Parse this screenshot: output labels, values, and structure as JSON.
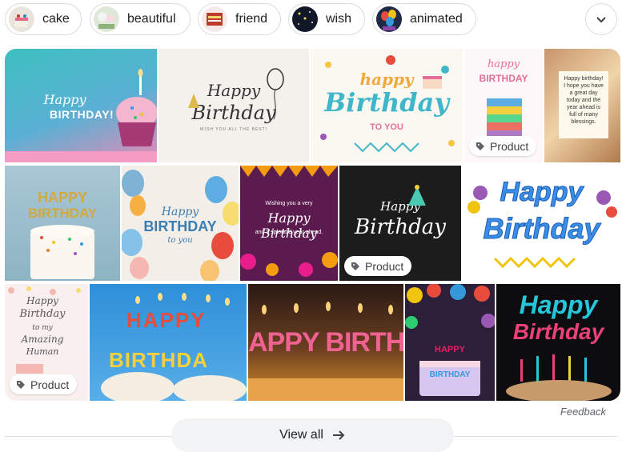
{
  "chips": [
    {
      "label": "cake",
      "icon": "cake-thumbnail"
    },
    {
      "label": "beautiful",
      "icon": "flowers-thumbnail"
    },
    {
      "label": "friend",
      "icon": "friend-card-thumbnail"
    },
    {
      "label": "wish",
      "icon": "night-sky-thumbnail"
    },
    {
      "label": "animated",
      "icon": "balloons-thumbnail"
    }
  ],
  "expand_icon": "chevron-down-icon",
  "tiles": {
    "t1": {
      "line1": "Happy",
      "line2": "BIRTHDAY!"
    },
    "t2": {
      "line1": "Happy",
      "line2": "Birthday",
      "sub": "WISH YOU ALL THE BEST!"
    },
    "t3": {
      "line1": "happy",
      "line2": "Birthday",
      "line3": "TO YOU"
    },
    "t4": {
      "line1": "happy",
      "line2": "BIRTHDAY",
      "badge": "Product"
    },
    "t5": {
      "text": "Happy birthday! I hope you have a great day today and the year ahead is full of many blessings."
    },
    "t6": {
      "line1": "HAPPY",
      "line2": "BIRTHDAY"
    },
    "t7": {
      "line1": "Happy",
      "line2": "BIRTHDAY",
      "line3": "to you"
    },
    "t8": {
      "line0": "Wishing you a very",
      "line1": "Happy Birthday",
      "line2": "and a splendid year ahead."
    },
    "t9": {
      "line1": "Happy",
      "line2": "Birthday",
      "badge": "Product"
    },
    "t10": {
      "line1": "Happy",
      "line2": "Birthday"
    },
    "t11": {
      "line1": "Happy",
      "line2": "Birthday",
      "line3": "to my",
      "line4": "Amazing",
      "line5": "Human",
      "badge": "Product"
    },
    "t12": {
      "line1": "HAPPY",
      "line2": "BIRTHDA"
    },
    "t13": {
      "text": "APPY BIRTHD"
    },
    "t14": {
      "line1": "HAPPY",
      "line2": "BIRTHDAY"
    },
    "t15": {
      "line1": "Happy",
      "line2": "Birthday"
    }
  },
  "product_icon": "tag-icon",
  "feedback": "Feedback",
  "view_all": {
    "label": "View all",
    "icon": "arrow-right-icon"
  },
  "colors": {
    "border": "#dadce0",
    "button_bg": "#f1f3f4",
    "text": "#202124",
    "muted": "#5f6368"
  }
}
